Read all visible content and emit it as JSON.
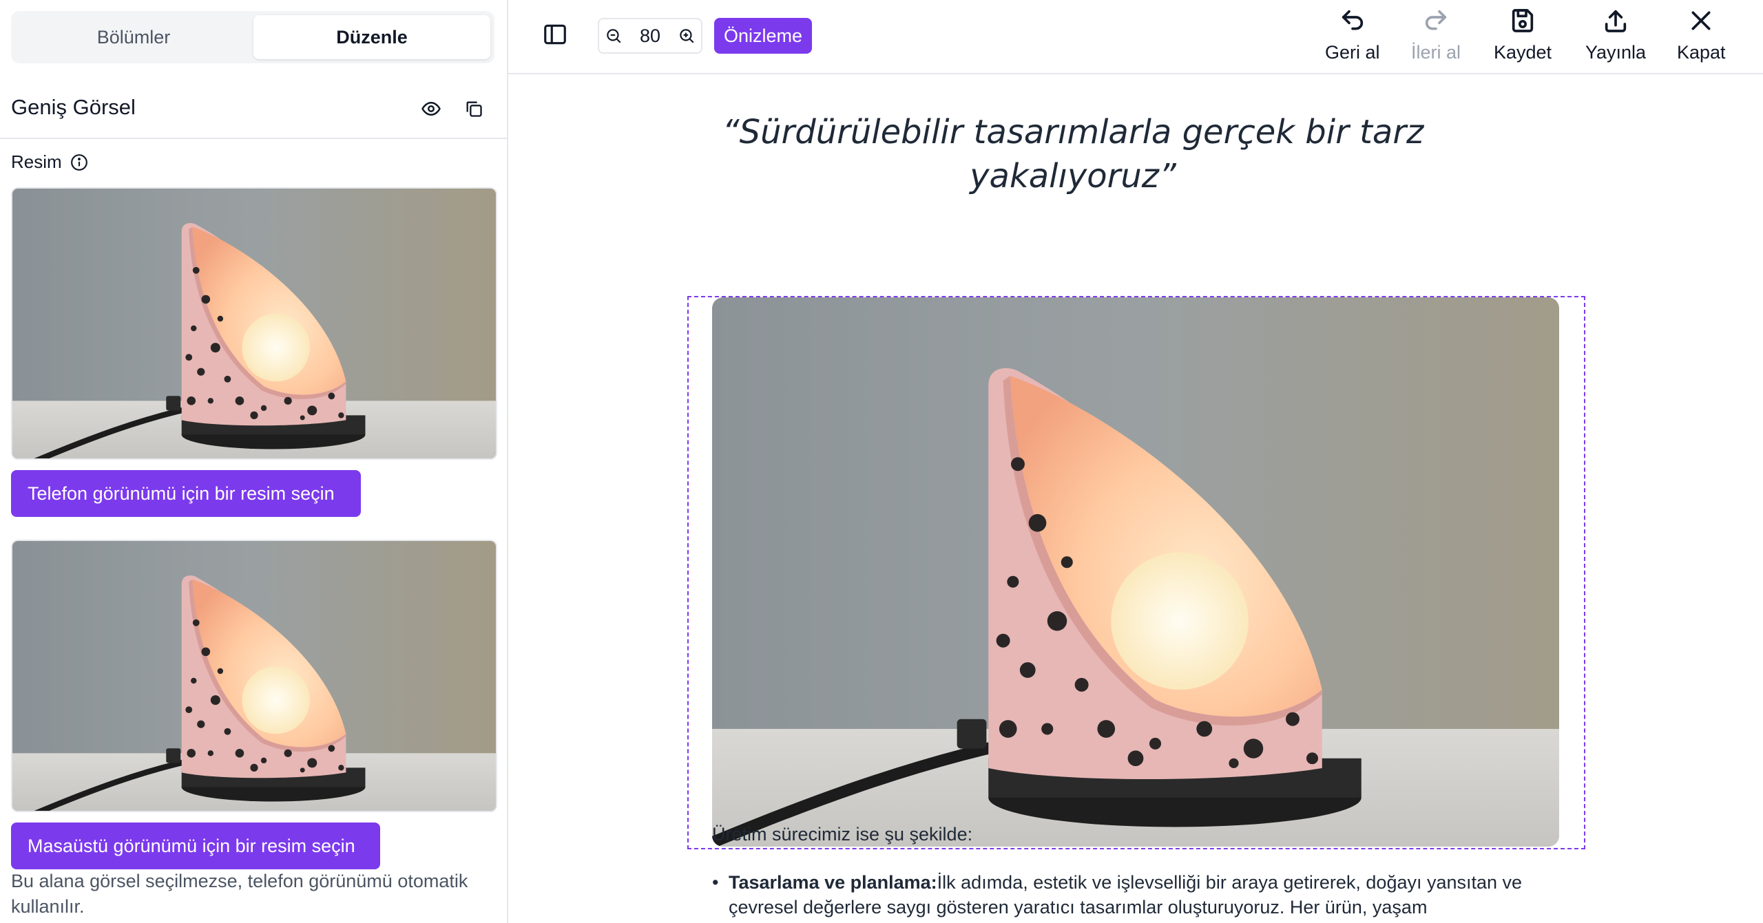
{
  "sidebar": {
    "tabs": [
      {
        "label": "Bölümler",
        "active": false
      },
      {
        "label": "Düzenle",
        "active": true
      }
    ],
    "section_title": "Geniş Görsel",
    "field_label": "Resim",
    "phone_button": "Telefon görünümü için bir resim seçin",
    "desktop_button": "Masaüstü görünümü için bir resim seçin",
    "help_text": "Bu alana görsel seçilmezse, telefon görünümü otomatik kullanılır."
  },
  "toolbar": {
    "zoom_value": "80",
    "preview_label": "Önizleme",
    "undo_label": "Geri al",
    "redo_label": "İleri al",
    "save_label": "Kaydet",
    "publish_label": "Yayınla",
    "close_label": "Kapat"
  },
  "canvas": {
    "quote": "“Sürdürülebilir tasarımlarla gerçek bir tarz yakalıyoruz”",
    "intro": "Üretim sürecimiz ise şu şekilde:",
    "bullet_bold": "Tasarlama ve planlama:",
    "bullet_text": "İlk adımda, estetik ve işlevselliği bir araya getirerek, doğayı yansıtan ve çevresel değerlere saygı gösteren yaratıcı tasarımlar oluşturuyoruz. Her ürün, yaşam"
  },
  "colors": {
    "accent": "#7c3aed",
    "border": "#e5e7eb",
    "muted_text": "#4b5563"
  },
  "icons": [
    "sidebar-toggle-icon",
    "zoom-out-icon",
    "zoom-in-icon",
    "undo-icon",
    "redo-icon",
    "save-icon",
    "publish-icon",
    "close-icon",
    "eye-icon",
    "copy-icon",
    "info-icon"
  ]
}
